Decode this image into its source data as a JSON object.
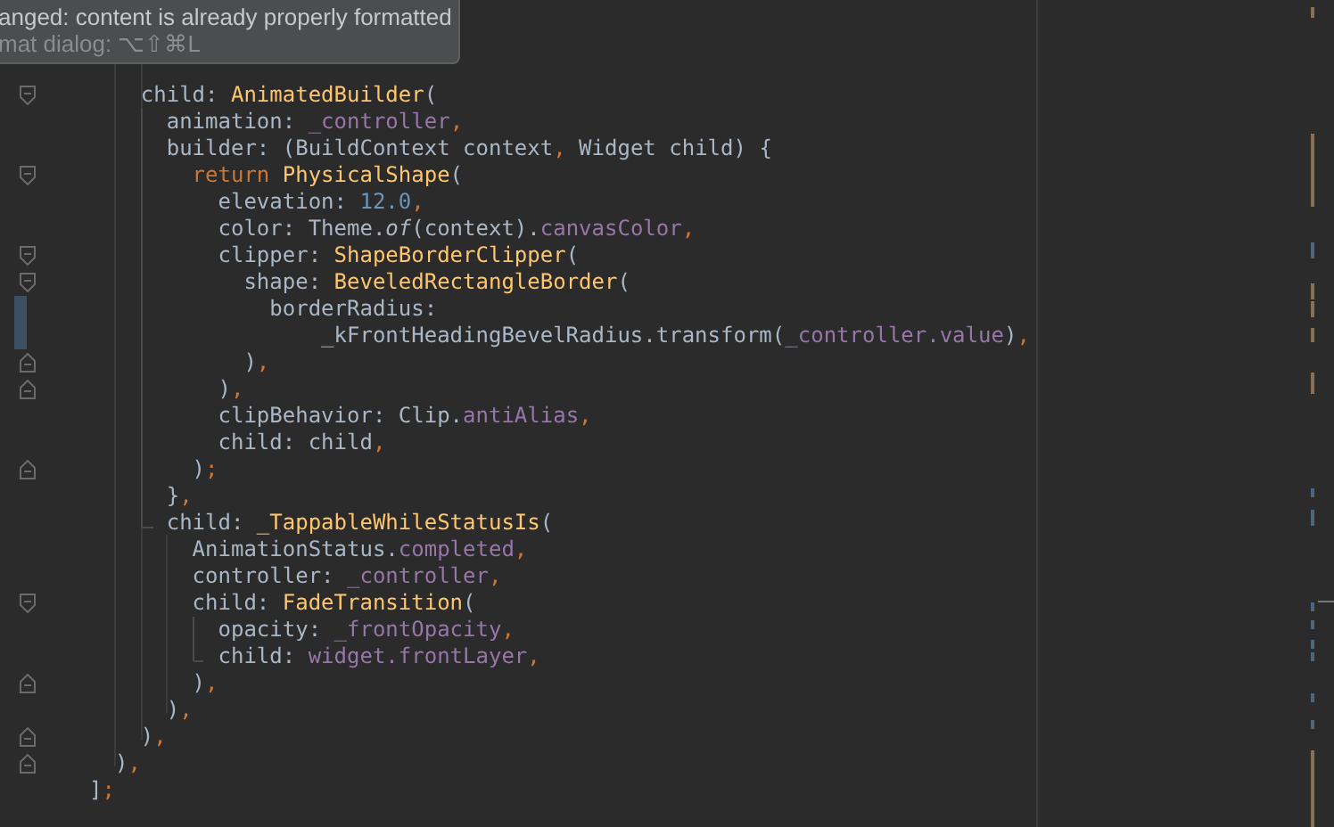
{
  "toast": {
    "message": "anged: content is already properly formatted",
    "hint": "mat dialog: ⌥⇧⌘L"
  },
  "lines": [
    {
      "changed": false,
      "fold_start": true,
      "fold_end": false,
      "tokens": [
        {
          "text": "    child: ",
          "kind": "plain"
        },
        {
          "text": "AnimatedBuilder",
          "kind": "class"
        },
        {
          "text": "(",
          "kind": "plain"
        }
      ]
    },
    {
      "changed": false,
      "fold_start": false,
      "fold_end": false,
      "tokens": [
        {
          "text": "      animation: ",
          "kind": "plain"
        },
        {
          "text": "_controller",
          "kind": "field"
        },
        {
          "text": ",",
          "kind": "punct"
        }
      ]
    },
    {
      "changed": false,
      "fold_start": false,
      "fold_end": false,
      "tokens": [
        {
          "text": "      builder: (BuildContext context",
          "kind": "plain"
        },
        {
          "text": ",",
          "kind": "punct"
        },
        {
          "text": " Widget child) {",
          "kind": "plain"
        }
      ]
    },
    {
      "changed": false,
      "fold_start": true,
      "fold_end": false,
      "tokens": [
        {
          "text": "        return ",
          "kind": "keyword"
        },
        {
          "text": "PhysicalShape",
          "kind": "class"
        },
        {
          "text": "(",
          "kind": "plain"
        }
      ]
    },
    {
      "changed": false,
      "fold_start": false,
      "fold_end": false,
      "tokens": [
        {
          "text": "          elevation: ",
          "kind": "plain"
        },
        {
          "text": "12.0",
          "kind": "number"
        },
        {
          "text": ",",
          "kind": "punct"
        }
      ]
    },
    {
      "changed": false,
      "fold_start": false,
      "fold_end": false,
      "tokens": [
        {
          "text": "          color: Theme.",
          "kind": "plain"
        },
        {
          "text": "of",
          "kind": "italic"
        },
        {
          "text": "(context).",
          "kind": "plain"
        },
        {
          "text": "canvasColor",
          "kind": "field"
        },
        {
          "text": ",",
          "kind": "punct"
        }
      ]
    },
    {
      "changed": false,
      "fold_start": true,
      "fold_end": false,
      "tokens": [
        {
          "text": "          clipper: ",
          "kind": "plain"
        },
        {
          "text": "ShapeBorderClipper",
          "kind": "class"
        },
        {
          "text": "(",
          "kind": "plain"
        }
      ]
    },
    {
      "changed": false,
      "fold_start": true,
      "fold_end": false,
      "tokens": [
        {
          "text": "            shape: ",
          "kind": "plain"
        },
        {
          "text": "BeveledRectangleBorder",
          "kind": "class"
        },
        {
          "text": "(",
          "kind": "plain"
        }
      ]
    },
    {
      "changed": true,
      "fold_start": false,
      "fold_end": false,
      "tokens": [
        {
          "text": "              borderRadius:",
          "kind": "plain"
        }
      ]
    },
    {
      "changed": true,
      "fold_start": false,
      "fold_end": false,
      "tokens": [
        {
          "text": "                  _kFrontHeadingBevelRadius.transform(",
          "kind": "plain"
        },
        {
          "text": "_controller.value",
          "kind": "field"
        },
        {
          "text": ")",
          "kind": "plain"
        },
        {
          "text": ",",
          "kind": "punct"
        }
      ]
    },
    {
      "changed": false,
      "fold_start": false,
      "fold_end": true,
      "tokens": [
        {
          "text": "            )",
          "kind": "plain"
        },
        {
          "text": ",",
          "kind": "punct"
        }
      ]
    },
    {
      "changed": false,
      "fold_start": false,
      "fold_end": true,
      "tokens": [
        {
          "text": "          )",
          "kind": "plain"
        },
        {
          "text": ",",
          "kind": "punct"
        }
      ]
    },
    {
      "changed": false,
      "fold_start": false,
      "fold_end": false,
      "tokens": [
        {
          "text": "          clipBehavior: Clip.",
          "kind": "plain"
        },
        {
          "text": "antiAlias",
          "kind": "field"
        },
        {
          "text": ",",
          "kind": "punct"
        }
      ]
    },
    {
      "changed": false,
      "fold_start": false,
      "fold_end": false,
      "tokens": [
        {
          "text": "          child: child",
          "kind": "plain"
        },
        {
          "text": ",",
          "kind": "punct"
        }
      ]
    },
    {
      "changed": false,
      "fold_start": false,
      "fold_end": true,
      "tokens": [
        {
          "text": "        )",
          "kind": "plain"
        },
        {
          "text": ";",
          "kind": "punct"
        }
      ]
    },
    {
      "changed": false,
      "fold_start": false,
      "fold_end": false,
      "tokens": [
        {
          "text": "      }",
          "kind": "plain"
        },
        {
          "text": ",",
          "kind": "punct"
        }
      ]
    },
    {
      "changed": false,
      "fold_start": false,
      "fold_end": false,
      "tokens": [
        {
          "text": "      child: ",
          "kind": "plain"
        },
        {
          "text": "_TappableWhileStatusIs",
          "kind": "class"
        },
        {
          "text": "(",
          "kind": "plain"
        }
      ]
    },
    {
      "changed": false,
      "fold_start": false,
      "fold_end": false,
      "tokens": [
        {
          "text": "        AnimationStatus.",
          "kind": "plain"
        },
        {
          "text": "completed",
          "kind": "field"
        },
        {
          "text": ",",
          "kind": "punct"
        }
      ]
    },
    {
      "changed": false,
      "fold_start": false,
      "fold_end": false,
      "tokens": [
        {
          "text": "        controller: ",
          "kind": "plain"
        },
        {
          "text": "_controller",
          "kind": "field"
        },
        {
          "text": ",",
          "kind": "punct"
        }
      ]
    },
    {
      "changed": false,
      "fold_start": true,
      "fold_end": false,
      "tokens": [
        {
          "text": "        child: ",
          "kind": "plain"
        },
        {
          "text": "FadeTransition",
          "kind": "class"
        },
        {
          "text": "(",
          "kind": "plain"
        }
      ]
    },
    {
      "changed": false,
      "fold_start": false,
      "fold_end": false,
      "tokens": [
        {
          "text": "          opacity: ",
          "kind": "plain"
        },
        {
          "text": "_frontOpacity",
          "kind": "field"
        },
        {
          "text": ",",
          "kind": "punct"
        }
      ]
    },
    {
      "changed": false,
      "fold_start": false,
      "fold_end": false,
      "tokens": [
        {
          "text": "          child: ",
          "kind": "plain"
        },
        {
          "text": "widget.frontLayer",
          "kind": "field"
        },
        {
          "text": ",",
          "kind": "punct"
        }
      ]
    },
    {
      "changed": false,
      "fold_start": false,
      "fold_end": true,
      "tokens": [
        {
          "text": "        )",
          "kind": "plain"
        },
        {
          "text": ",",
          "kind": "punct"
        }
      ]
    },
    {
      "changed": false,
      "fold_start": false,
      "fold_end": false,
      "tokens": [
        {
          "text": "      )",
          "kind": "plain"
        },
        {
          "text": ",",
          "kind": "punct"
        }
      ]
    },
    {
      "changed": false,
      "fold_start": false,
      "fold_end": true,
      "tokens": [
        {
          "text": "    )",
          "kind": "plain"
        },
        {
          "text": ",",
          "kind": "punct"
        }
      ]
    },
    {
      "changed": false,
      "fold_start": false,
      "fold_end": true,
      "tokens": [
        {
          "text": "  )",
          "kind": "plain"
        },
        {
          "text": ",",
          "kind": "punct"
        }
      ]
    },
    {
      "changed": false,
      "fold_start": false,
      "fold_end": false,
      "tokens": [
        {
          "text": "]",
          "kind": "plain"
        },
        {
          "text": ";",
          "kind": "punct"
        }
      ]
    }
  ]
}
